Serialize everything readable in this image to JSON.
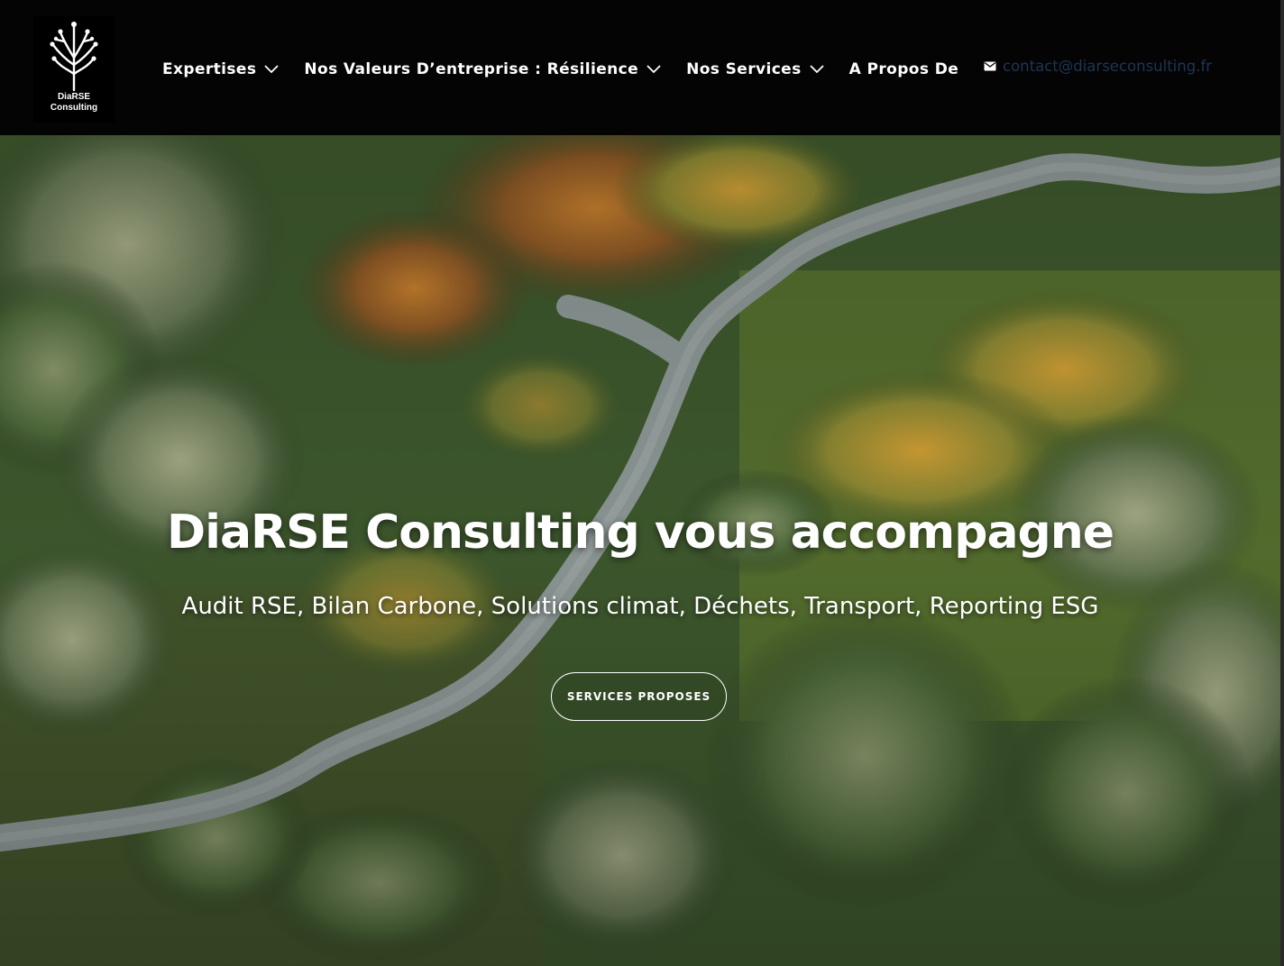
{
  "logo": {
    "line1": "DiaRSE",
    "line2": "Consulting"
  },
  "nav": {
    "expertises": "Expertises",
    "valeurs": "Nos Valeurs D’entreprise : Résilience",
    "services": "Nos Services",
    "apropos": "A Propos De"
  },
  "contact": {
    "email": "contact@diarseconsulting.fr",
    "icon": "envelope-icon",
    "color": "#1f3554"
  },
  "hero": {
    "title": "DiaRSE Consulting vous accompagne",
    "subtitle": "Audit RSE, Bilan Carbone, Solutions climat, Déchets, Transport, Reporting ESG",
    "button": "SERVICES PROPOSES"
  }
}
